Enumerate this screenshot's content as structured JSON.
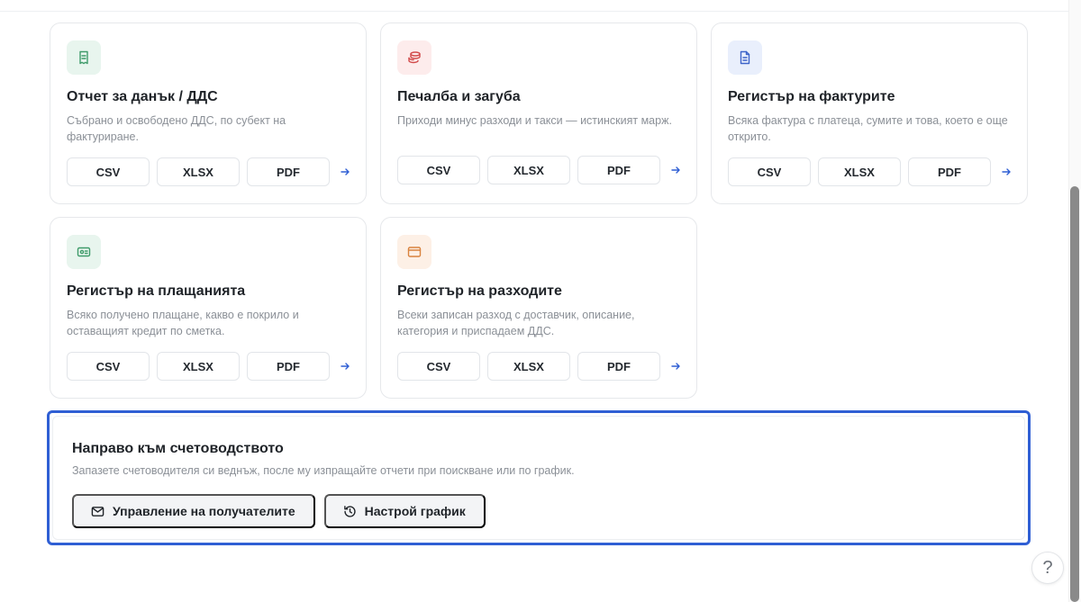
{
  "cards": [
    {
      "title": "Отчет за данък / ДДС",
      "desc": "Събрано и освободено ДДС, по субект на фактуриране.",
      "icon": "receipt-icon",
      "formats": [
        "CSV",
        "XLSX",
        "PDF"
      ]
    },
    {
      "title": "Печалба и загуба",
      "desc": "Приходи минус разходи и такси — истинският марж.",
      "icon": "coins-icon",
      "formats": [
        "CSV",
        "XLSX",
        "PDF"
      ]
    },
    {
      "title": "Регистър на фактурите",
      "desc": "Всяка фактура с платеца, сумите и това, което е още открито.",
      "icon": "invoice-icon",
      "formats": [
        "CSV",
        "XLSX",
        "PDF"
      ]
    },
    {
      "title": "Регистър на плащанията",
      "desc": "Всяко получено плащане, какво е покрило и оставащият кредит по сметка.",
      "icon": "payment-icon",
      "formats": [
        "CSV",
        "XLSX",
        "PDF"
      ]
    },
    {
      "title": "Регистър на разходите",
      "desc": "Всеки записан разход с доставчик, описание, категория и приспадаем ДДС.",
      "icon": "wallet-icon",
      "formats": [
        "CSV",
        "XLSX",
        "PDF"
      ]
    }
  ],
  "accounting": {
    "title": "Направо към счетоводството",
    "desc": "Запазете счетоводителя си веднъж, после му изпращайте отчети при поискване или по график.",
    "manage_label": "Управление на получателите",
    "schedule_label": "Настрой график"
  },
  "help": {
    "label": "?"
  },
  "colors": {
    "accent": "#2f5fd4",
    "green_tile": "#e8f5ee",
    "red_tile": "#fdecec",
    "blue_tile": "#e9effc",
    "orange_tile": "#fdf0e6"
  }
}
